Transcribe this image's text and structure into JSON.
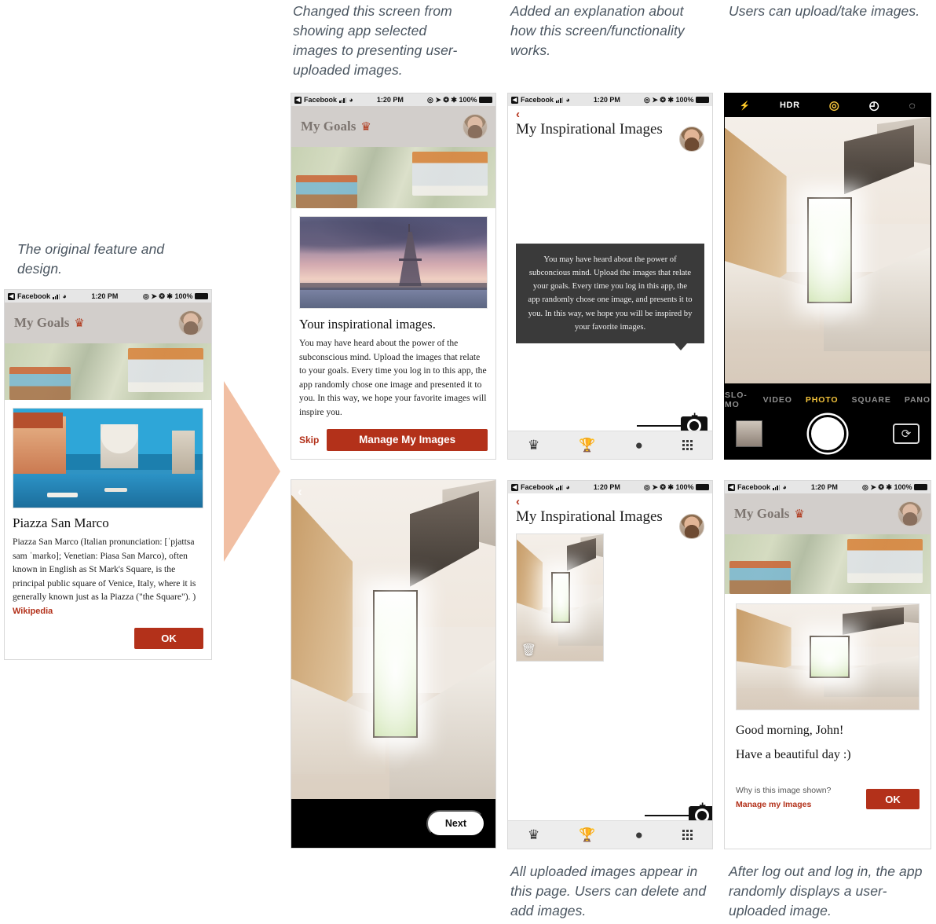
{
  "annotations": {
    "original": "The original feature and design.",
    "changed_screen": "Changed this screen from showing app selected images to presenting user-uploaded images.",
    "added_explanation": "Added an explanation about how this screen/functionality works.",
    "upload_take": "Users can upload/take images.",
    "all_uploaded": "All uploaded images appear in this page. Users can delete and add images.",
    "after_login": "After log out and log in, the app randomly displays a user-uploaded image."
  },
  "status_bar": {
    "carrier": "Facebook",
    "time": "1:20 PM",
    "battery": "100%",
    "back_glyph": "◀",
    "wifi_icon": "wifi-icon",
    "signal_icon": "cellular-signal-icon",
    "alarm_icon": "◎",
    "location_icon": "➤",
    "rotation_lock_icon": "❂",
    "bluetooth_icon": "✱"
  },
  "goals_header": {
    "title": "My Goals",
    "crown_icon": "♛"
  },
  "screen1_venice": {
    "title": "Piazza San Marco",
    "body": "Piazza San Marco (Italian pronunciation: [ˈpjattsa sam ˈmarko]; Venetian: Piasa San Marco), often known in English as St Mark's Square, is the principal public square of Venice, Italy, where it is generally known just as la Piazza (\"the Square\"). )",
    "source_link": "Wikipedia",
    "ok_button": "OK"
  },
  "screen2_inspirational": {
    "heading": "Your inspirational images.",
    "body": "You may have heard about the power of the subconscious mind. Upload the images that relate to your goals. Every time you log in to this app, the app randomly chose one image and presented it to you. In this way, we hope your favorite images will inspire you.",
    "skip_label": "Skip",
    "primary_button": "Manage My Images",
    "photo_alt": "eiffel-tower-photo"
  },
  "screen3_my_images": {
    "nav_title": "My Inspirational Images",
    "back_icon": "‹",
    "tooltip": "You may have heard about the power of subconcious mind. Upload the images that relate your goals. Every time you log in this app, the app randomly chose one image, and presents it to you. In this way, we hope you will be inspired by your favorite images."
  },
  "tab_bar": {
    "items": [
      {
        "icon": "crown-icon",
        "glyph": "♛"
      },
      {
        "icon": "trophy-icon",
        "glyph": "Ἴ6"
      },
      {
        "icon": "book-icon",
        "glyph": "◘"
      },
      {
        "icon": "grid-icon",
        "glyph": "grid"
      }
    ],
    "add_photo_icon": "add-photo-camera-icon"
  },
  "camera_screen": {
    "flash_icon": "⚡",
    "hdr_label": "HDR",
    "live_icon": "◎",
    "timer_icon": "◴",
    "filters_icon": "filters-icon",
    "modes": [
      "SLO-MO",
      "VIDEO",
      "PHOTO",
      "SQUARE",
      "PANO"
    ],
    "active_mode": "PHOTO",
    "shutter": "shutter-button",
    "gallery_thumb": "gallery-thumbnail",
    "flip_icon": "flip-camera-icon"
  },
  "screen4_preview": {
    "back_icon": "‹",
    "next_button": "Next"
  },
  "screen5_gallery": {
    "nav_title": "My Inspirational Images",
    "back_icon": "‹",
    "delete_icon": "🗑",
    "image_alt": "kitchen-photo"
  },
  "screen6_greeting": {
    "greeting": "Good morning, John!",
    "subline": "Have a beautiful day :)",
    "why_label": "Why is this image shown?",
    "manage_link": "Manage my Images",
    "ok_button": "OK"
  },
  "colors": {
    "accent_red": "#b3311a",
    "arrow_peach": "#f1bfa3",
    "annotation_text": "#4a5560",
    "tooltip_bg": "#3a3a3a"
  }
}
